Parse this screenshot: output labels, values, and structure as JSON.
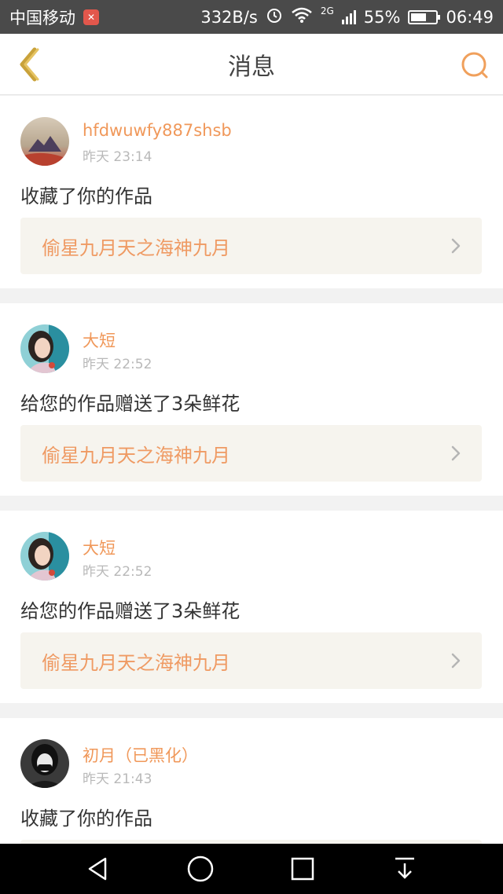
{
  "status_bar": {
    "carrier": "中国移动",
    "net_speed": "332B/s",
    "network_type": "2G",
    "battery": "55%",
    "time": "06:49",
    "icons": [
      "app-badge-icon",
      "alarm-icon",
      "wifi-icon",
      "signal-icon",
      "battery-icon"
    ]
  },
  "header": {
    "title": "消息",
    "back_icon": "back-chevron-icon",
    "search_icon": "search-icon"
  },
  "notifications": [
    {
      "username": "hfdwuwfy887shsb",
      "time": "昨天 23:14",
      "message": "收藏了你的作品",
      "work_title": "偷星九月天之海神九月"
    },
    {
      "username": "大短",
      "time": "昨天 22:52",
      "message": "给您的作品赠送了3朵鲜花",
      "work_title": "偷星九月天之海神九月"
    },
    {
      "username": "大短",
      "time": "昨天 22:52",
      "message": "给您的作品赠送了3朵鲜花",
      "work_title": "偷星九月天之海神九月"
    },
    {
      "username": "初月（已黑化）",
      "time": "昨天 21:43",
      "message": "收藏了你的作品",
      "work_title": ""
    }
  ],
  "colors": {
    "accent": "#f0985a",
    "link_bg": "#f6f4ee",
    "status_bar": "#4a4a4a",
    "nav_bar": "#000000"
  },
  "nav_bar": {
    "icons": [
      "back-triangle-icon",
      "home-circle-icon",
      "recents-square-icon",
      "notification-pull-icon"
    ]
  }
}
